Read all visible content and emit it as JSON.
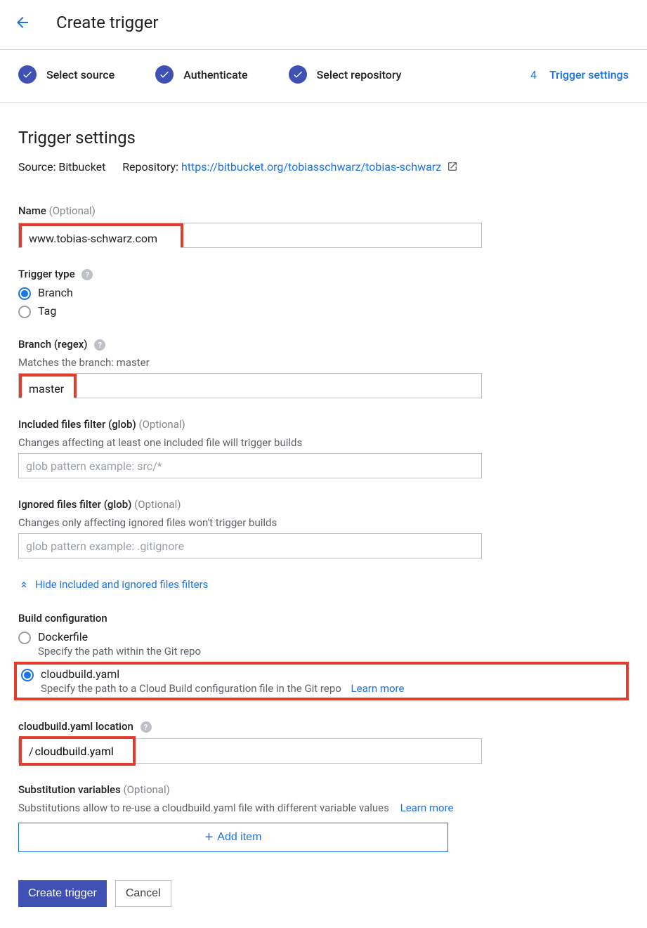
{
  "header": {
    "title": "Create trigger"
  },
  "stepper": {
    "steps": [
      "Select source",
      "Authenticate",
      "Select repository"
    ],
    "active_num": "4",
    "active_label": "Trigger settings"
  },
  "section": {
    "heading": "Trigger settings",
    "source_label": "Source:",
    "source_value": "Bitbucket",
    "repo_label": "Repository:",
    "repo_url": "https://bitbucket.org/tobiasschwarz/tobias-schwarz"
  },
  "name": {
    "label": "Name",
    "optional": "(Optional)",
    "value": "www.tobias-schwarz.com"
  },
  "trigger_type": {
    "label": "Trigger type",
    "branch": "Branch",
    "tag": "Tag"
  },
  "branch": {
    "label": "Branch (regex)",
    "hint": "Matches the branch: master",
    "value": "master"
  },
  "included": {
    "label": "Included files filter (glob)",
    "optional": "(Optional)",
    "hint": "Changes affecting at least one included file will trigger builds",
    "placeholder": "glob pattern example: src/*"
  },
  "ignored": {
    "label": "Ignored files filter (glob)",
    "optional": "(Optional)",
    "hint": "Changes only affecting ignored files won't trigger builds",
    "placeholder": "glob pattern example: .gitignore"
  },
  "toggle_filters": "Hide included and ignored files filters",
  "build_config": {
    "label": "Build configuration",
    "dockerfile": "Dockerfile",
    "dockerfile_desc": "Specify the path within the Git repo",
    "cloudbuild": "cloudbuild.yaml",
    "cloudbuild_desc": "Specify the path to a Cloud Build configuration file in the Git repo",
    "learn_more": "Learn more"
  },
  "yaml_location": {
    "label": "cloudbuild.yaml location",
    "prefix": "/",
    "value": "cloudbuild.yaml"
  },
  "substitution": {
    "label": "Substitution variables",
    "optional": "(Optional)",
    "desc": "Substitutions allow to re-use a cloudbuild.yaml file with different variable values",
    "learn_more": "Learn more",
    "add_item": "Add item"
  },
  "actions": {
    "create": "Create trigger",
    "cancel": "Cancel"
  }
}
